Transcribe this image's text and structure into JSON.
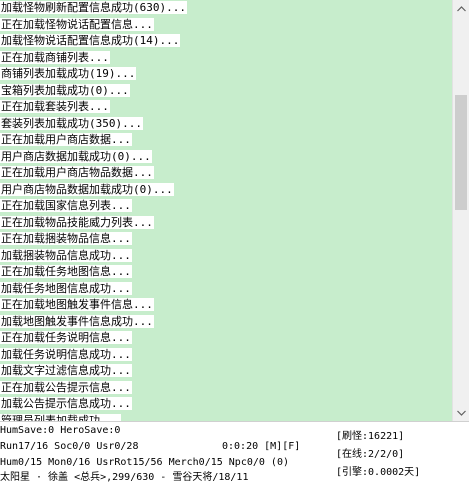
{
  "log": {
    "lines": [
      "加载怪物刷新配置信息成功(630)...",
      "正在加载怪物说话配置信息...",
      "加载怪物说话配置信息成功(14)...",
      "正在加载商铺列表...",
      "商铺列表加载成功(19)...",
      "宝箱列表加载成功(0)...",
      "正在加载套装列表...",
      "套装列表加载成功(350)...",
      "正在加载用户商店数据...",
      "用户商店数据加载成功(0)...",
      "正在加载用户商店物品数据...",
      "用户商店物品数据加载成功(0)...",
      "正在加载国家信息列表...",
      "正在加载物品技能威力列表...",
      "正在加载捆装物品信息...",
      "加载捆装物品信息成功...",
      "正在加载任务地图信息...",
      "加载任务地图信息成功...",
      "正在加载地图触发事件信息...",
      "加载地图触发事件信息成功...",
      "正在加载任务说明信息...",
      "加载任务说明信息成功...",
      "加载文字过滤信息成功...",
      "正在加载公告提示信息...",
      "加载公告提示信息成功...",
      "管理员列表加载成功..."
    ]
  },
  "status": {
    "hum_save": "HumSave:0 HeroSave:0",
    "run_line": "Run17/16 Soc0/0 Usr0/28",
    "clock": "0:0:20 [M][F]",
    "hum_line": "Hum0/15 Mon0/16 UsrRot15/56 Merch0/15 Npc0/0 (0)",
    "server_line": "太阳星 · 徐盖 <总兵>,299/630 - 雪谷天将/18/11",
    "monster_refresh": "[刷怪:16221]",
    "online": "[在线:2/2/0]",
    "engine": "[引擎:0.0002天]"
  },
  "colors": {
    "log_background": "#c7edcc",
    "text_highlight": "#ffffff",
    "scrollbar_thumb": "#cdcdcd"
  }
}
